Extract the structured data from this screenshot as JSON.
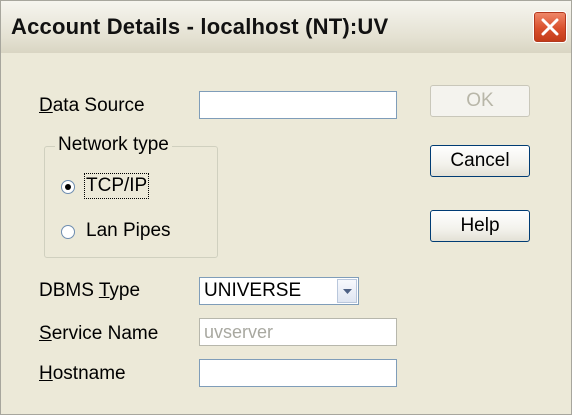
{
  "window": {
    "title": "Account Details - localhost (NT):UV"
  },
  "form": {
    "data_source": {
      "label_pre": "",
      "label_u": "D",
      "label_post": "ata Source",
      "value": ""
    },
    "network_type": {
      "legend": "Network type",
      "options": [
        {
          "label": "TCP/IP",
          "selected": true
        },
        {
          "label": "Lan Pipes",
          "selected": false
        }
      ]
    },
    "dbms_type": {
      "label_pre": "DBMS ",
      "label_u": "T",
      "label_post": "ype",
      "value": "UNIVERSE"
    },
    "service_name": {
      "label_pre": "",
      "label_u": "S",
      "label_post": "ervice Name",
      "value": "uvserver"
    },
    "hostname": {
      "label_pre": "",
      "label_u": "H",
      "label_post": "ostname",
      "value": ""
    }
  },
  "buttons": {
    "ok": "OK",
    "cancel": "Cancel",
    "help": "Help"
  },
  "icons": {
    "close": "close-icon",
    "dropdown": "chevron-down-icon"
  },
  "colors": {
    "close_button": "#d9502d",
    "window_bg": "#ece9d8"
  }
}
